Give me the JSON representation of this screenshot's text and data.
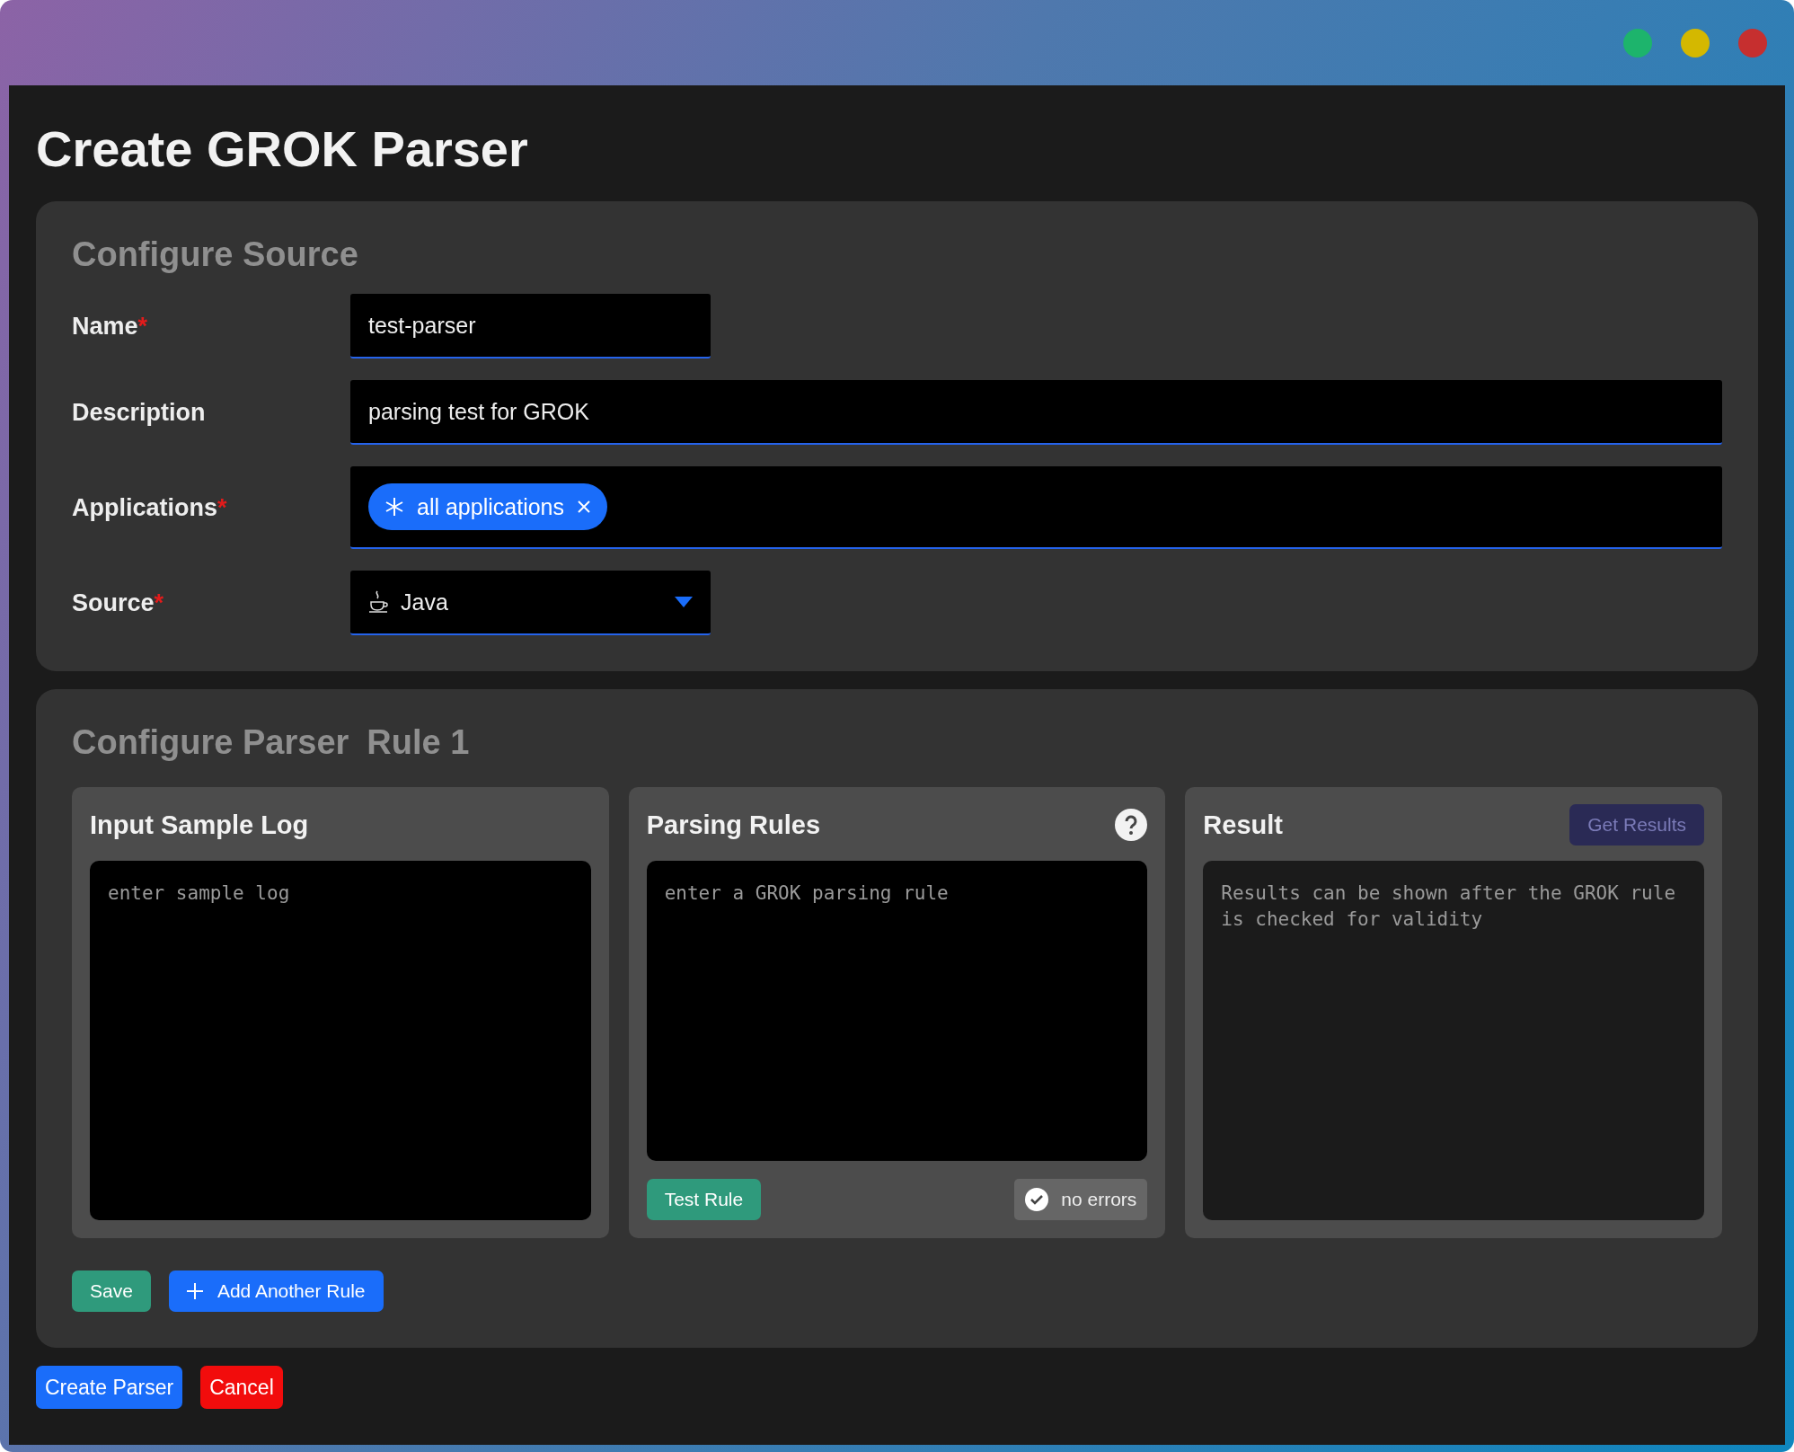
{
  "window_controls": [
    {
      "color": "#1db46c"
    },
    {
      "color": "#d4b800"
    },
    {
      "color": "#c62f2f"
    }
  ],
  "title": "Create GROK Parser",
  "required_marker": "*",
  "source_section": {
    "title": "Configure Source",
    "fields": [
      {
        "kind": "text",
        "label": "Name",
        "required": true,
        "value": "test-parser",
        "wide": false
      },
      {
        "kind": "text",
        "label": "Description",
        "required": false,
        "value": "parsing test for GROK",
        "wide": true
      },
      {
        "kind": "tags",
        "label": "Applications",
        "required": true,
        "tags": [
          "all applications"
        ],
        "wide": true
      },
      {
        "kind": "select",
        "label": "Source",
        "required": true,
        "value": "Java",
        "wide": false
      }
    ]
  },
  "parser_section": {
    "title": "Configure Parser",
    "rule_label": "Rule 1",
    "input_panel": {
      "title": "Input Sample Log",
      "placeholder": "enter sample log"
    },
    "rules_panel": {
      "title": "Parsing Rules",
      "placeholder": "enter a GROK parsing rule",
      "test_button": "Test Rule",
      "status": {
        "text": "no errors",
        "ok": true
      }
    },
    "result_panel": {
      "title": "Result",
      "button": {
        "label": "Get Results",
        "disabled": true
      },
      "message": "Results can be shown after the GROK rule is checked for validity"
    },
    "save_button": "Save",
    "add_button": "Add Another Rule"
  },
  "footer_buttons": [
    {
      "label": "Create Parser",
      "kind": "primary"
    },
    {
      "label": "Cancel",
      "kind": "danger"
    }
  ]
}
